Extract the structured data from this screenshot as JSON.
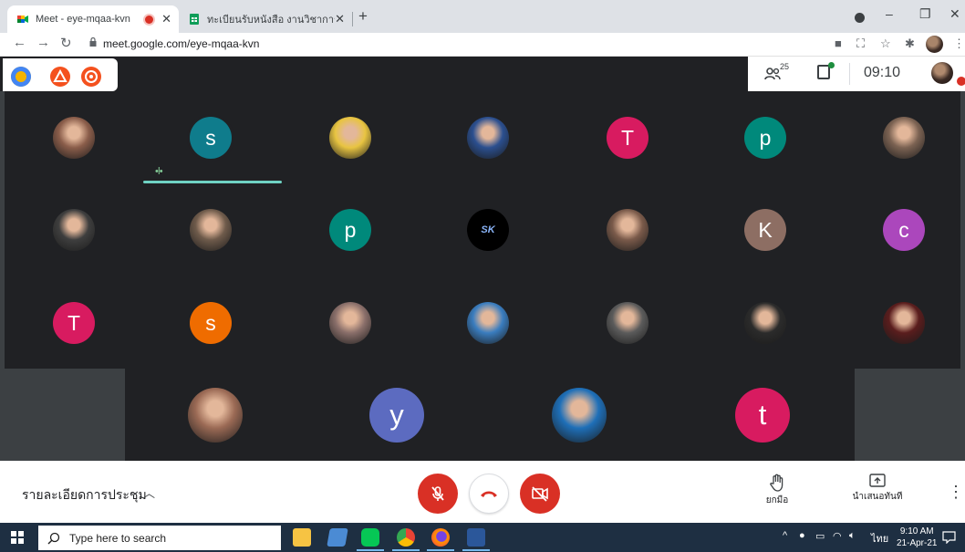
{
  "browser": {
    "tabs": [
      {
        "title": "Meet - eye-mqaa-kvn",
        "active": true,
        "recording": true
      },
      {
        "title": "ทะเบียนรับหนังสือ งานวิชาการฯ - Goo",
        "active": false
      }
    ],
    "new_tab": "+",
    "window_controls": {
      "minimize": "–",
      "restore": "❐",
      "close": "✕"
    },
    "url": "meet.google.com/eye-mqaa-kvn"
  },
  "meet_top": {
    "participant_count": "25",
    "time": "09:10"
  },
  "participants": [
    {
      "id": "p1",
      "initial": "",
      "color": "#8a5d4a",
      "photo": true
    },
    {
      "id": "p2",
      "initial": "s",
      "color": "#0f7c8c",
      "photo": false,
      "speaking": true
    },
    {
      "id": "p3",
      "initial": "",
      "color": "#e8c441",
      "photo": true
    },
    {
      "id": "p4",
      "initial": "",
      "color": "#2b4f8f",
      "photo": true
    },
    {
      "id": "p5",
      "initial": "T",
      "color": "#d81b60",
      "photo": false
    },
    {
      "id": "p6",
      "initial": "p",
      "color": "#00897b",
      "photo": false
    },
    {
      "id": "p7",
      "initial": "",
      "color": "#7b6252",
      "photo": true
    },
    {
      "id": "p8",
      "initial": "",
      "color": "#3e3e3e",
      "photo": true
    },
    {
      "id": "p9",
      "initial": "",
      "color": "#6f5b4b",
      "photo": true
    },
    {
      "id": "p10",
      "initial": "p",
      "color": "#00897b",
      "photo": false
    },
    {
      "id": "p11",
      "initial": "SK",
      "color": "#000000",
      "photo": false
    },
    {
      "id": "p12",
      "initial": "",
      "color": "#7a5a4a",
      "photo": true
    },
    {
      "id": "p13",
      "initial": "K",
      "color": "#8d6e63",
      "photo": false
    },
    {
      "id": "p14",
      "initial": "c",
      "color": "#ab47bc",
      "photo": false
    },
    {
      "id": "p15",
      "initial": "T",
      "color": "#d81b60",
      "photo": false
    },
    {
      "id": "p16",
      "initial": "s",
      "color": "#ef6c00",
      "photo": false
    },
    {
      "id": "p17",
      "initial": "",
      "color": "#8a6f6a",
      "photo": true
    },
    {
      "id": "p18",
      "initial": "",
      "color": "#3a7dbf",
      "photo": true
    },
    {
      "id": "p19",
      "initial": "",
      "color": "#5b5b5b",
      "photo": true
    },
    {
      "id": "p20",
      "initial": "",
      "color": "#2b2b2b",
      "photo": true
    },
    {
      "id": "p21",
      "initial": "",
      "color": "#5a1d1d",
      "photo": true
    },
    {
      "id": "p22",
      "initial": "",
      "color": "#9b6a55",
      "photo": true
    },
    {
      "id": "p23",
      "initial": "y",
      "color": "#5c6bc0",
      "photo": false
    },
    {
      "id": "p24",
      "initial": "",
      "color": "#1e6fb8",
      "photo": true
    },
    {
      "id": "p25",
      "initial": "t",
      "color": "#d81b60",
      "photo": false
    }
  ],
  "bottom_bar": {
    "meeting_details": "รายละเอียดการประชุม",
    "raise_hand": "ยกมือ",
    "present_now": "นำเสนอทันที"
  },
  "taskbar": {
    "search_placeholder": "Type here to search",
    "language": "ไทย",
    "time": "9:10 AM",
    "date": "21-Apr-21"
  },
  "colors": {
    "meet_dark": "#202124",
    "tile_gray": "#3c4043",
    "end_red": "#d93025",
    "speaking_teal": "#6fd2c3",
    "taskbar": "#1e2f42"
  }
}
